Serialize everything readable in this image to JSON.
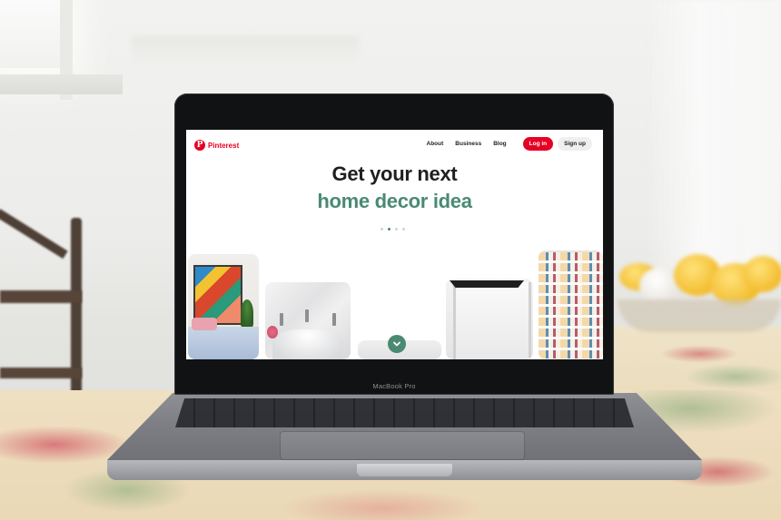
{
  "site": {
    "brand": "Pinterest",
    "logo_glyph": "P",
    "nav": {
      "about": "About",
      "business": "Business",
      "blog": "Blog",
      "login": "Log in",
      "signup": "Sign up"
    },
    "headline": "Get your next",
    "subheadline": "home decor idea",
    "carousel": {
      "dots": 4,
      "active_index": 1
    },
    "colors": {
      "brand": "#e60023",
      "accent": "#4a8a73"
    }
  },
  "device": {
    "label": "MacBook Pro"
  },
  "icons": {
    "scroll": "chevron-down-icon",
    "logo": "pinterest-logo-icon"
  }
}
